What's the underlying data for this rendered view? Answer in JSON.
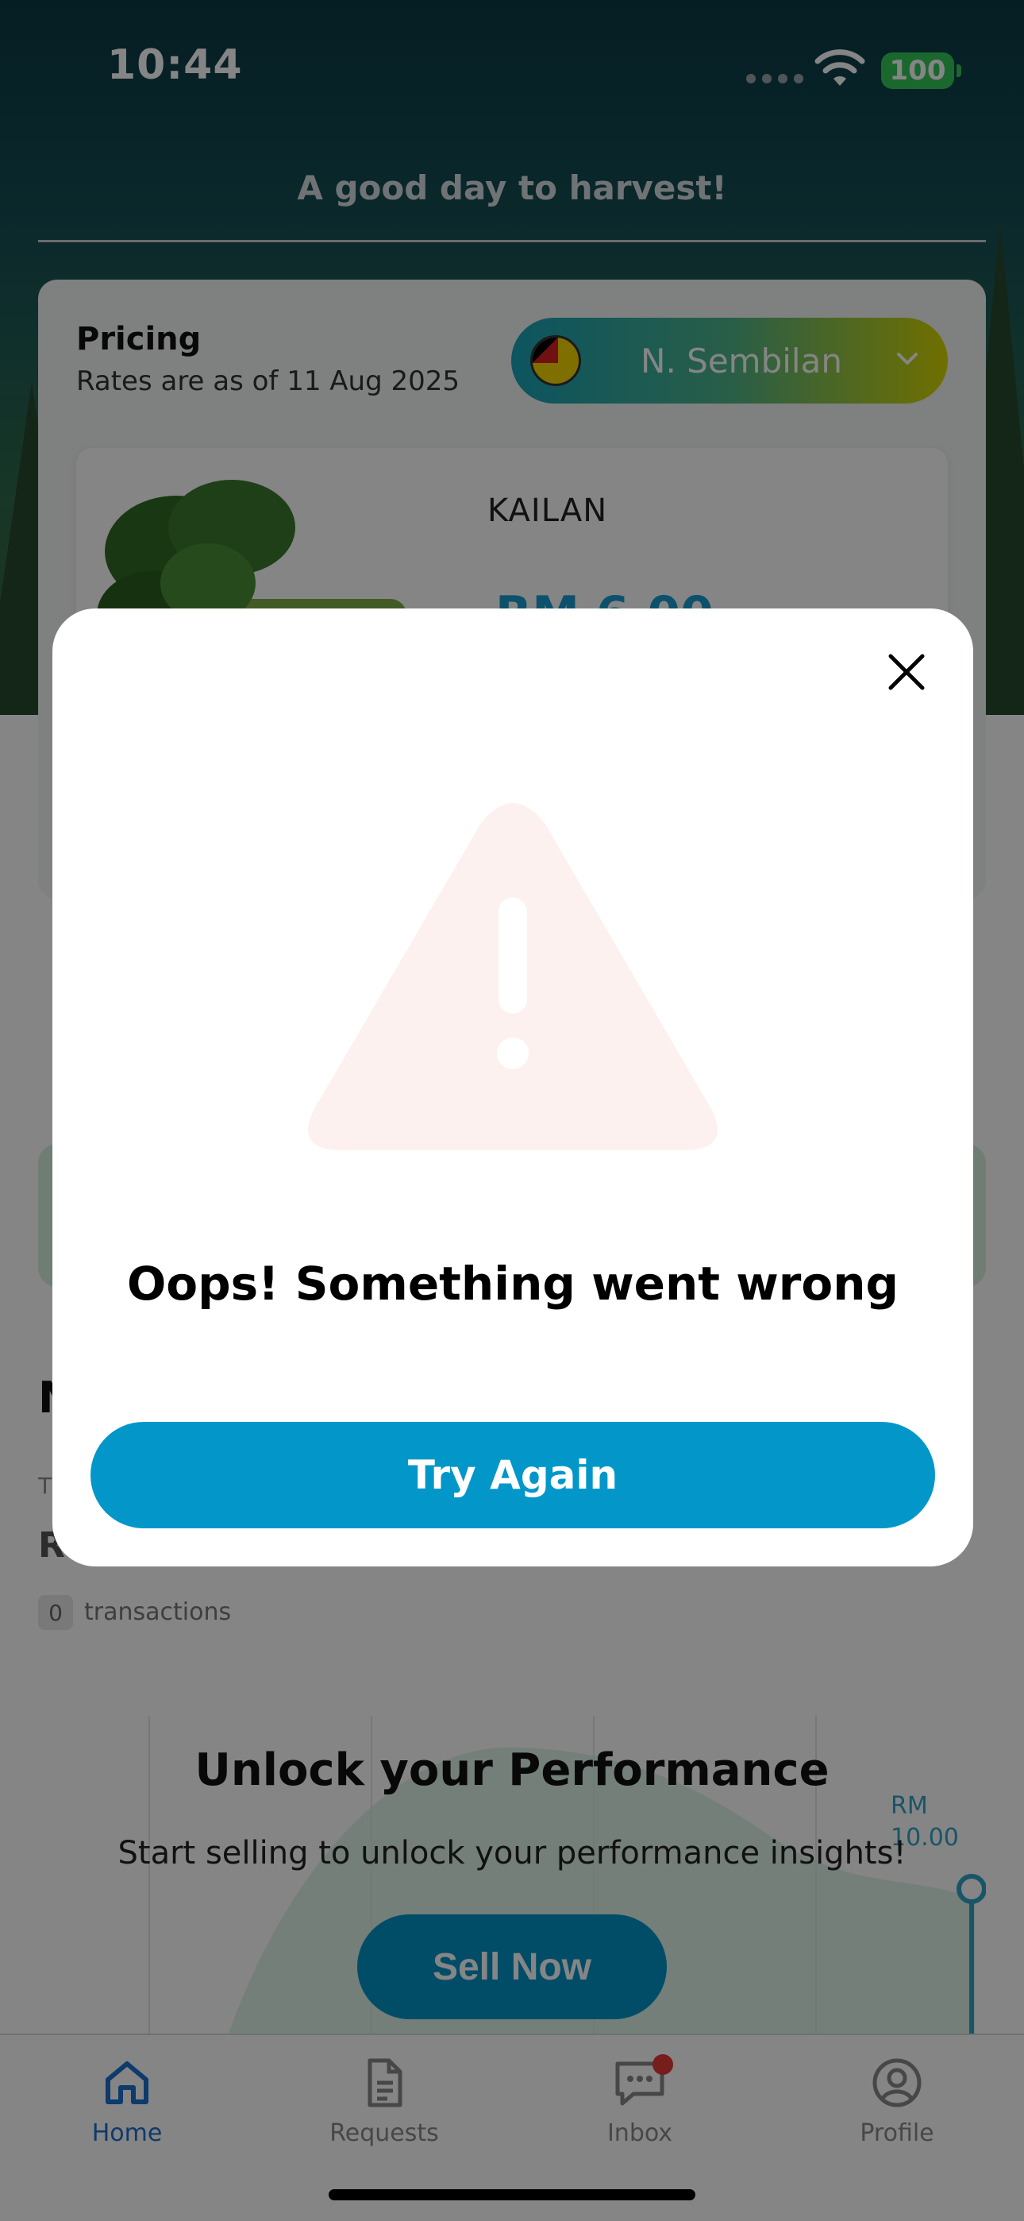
{
  "status_bar": {
    "time": "10:44",
    "battery": "100"
  },
  "header": {
    "greeting": "A good day to harvest!"
  },
  "pricing": {
    "title": "Pricing",
    "subtitle": "Rates are as of 11 Aug 2025",
    "region": "N. Sembilan",
    "crop": {
      "name": "KAILAN",
      "price": "RM 6.00"
    }
  },
  "sales": {
    "heading": "N",
    "sub": "T",
    "amount": "R",
    "transaction_count": "0",
    "transaction_label": "transactions"
  },
  "performance": {
    "title": "Unlock your Performance",
    "subtitle": "Start selling to unlock your performance insights!",
    "cta": "Sell Now",
    "chart_label": "RM\n10.00"
  },
  "tabs": [
    {
      "label": "Home",
      "icon": "home-icon",
      "active": true
    },
    {
      "label": "Requests",
      "icon": "document-icon",
      "active": false
    },
    {
      "label": "Inbox",
      "icon": "chat-icon",
      "active": false,
      "badge": true
    },
    {
      "label": "Profile",
      "icon": "profile-icon",
      "active": false
    }
  ],
  "modal": {
    "title": "Oops! Something went wrong",
    "button": "Try Again",
    "icon": "warning-icon"
  },
  "colors": {
    "accent": "#0397c9",
    "active_tab": "#1b6fcf",
    "badge": "#e53935",
    "battery": "#35c759"
  }
}
